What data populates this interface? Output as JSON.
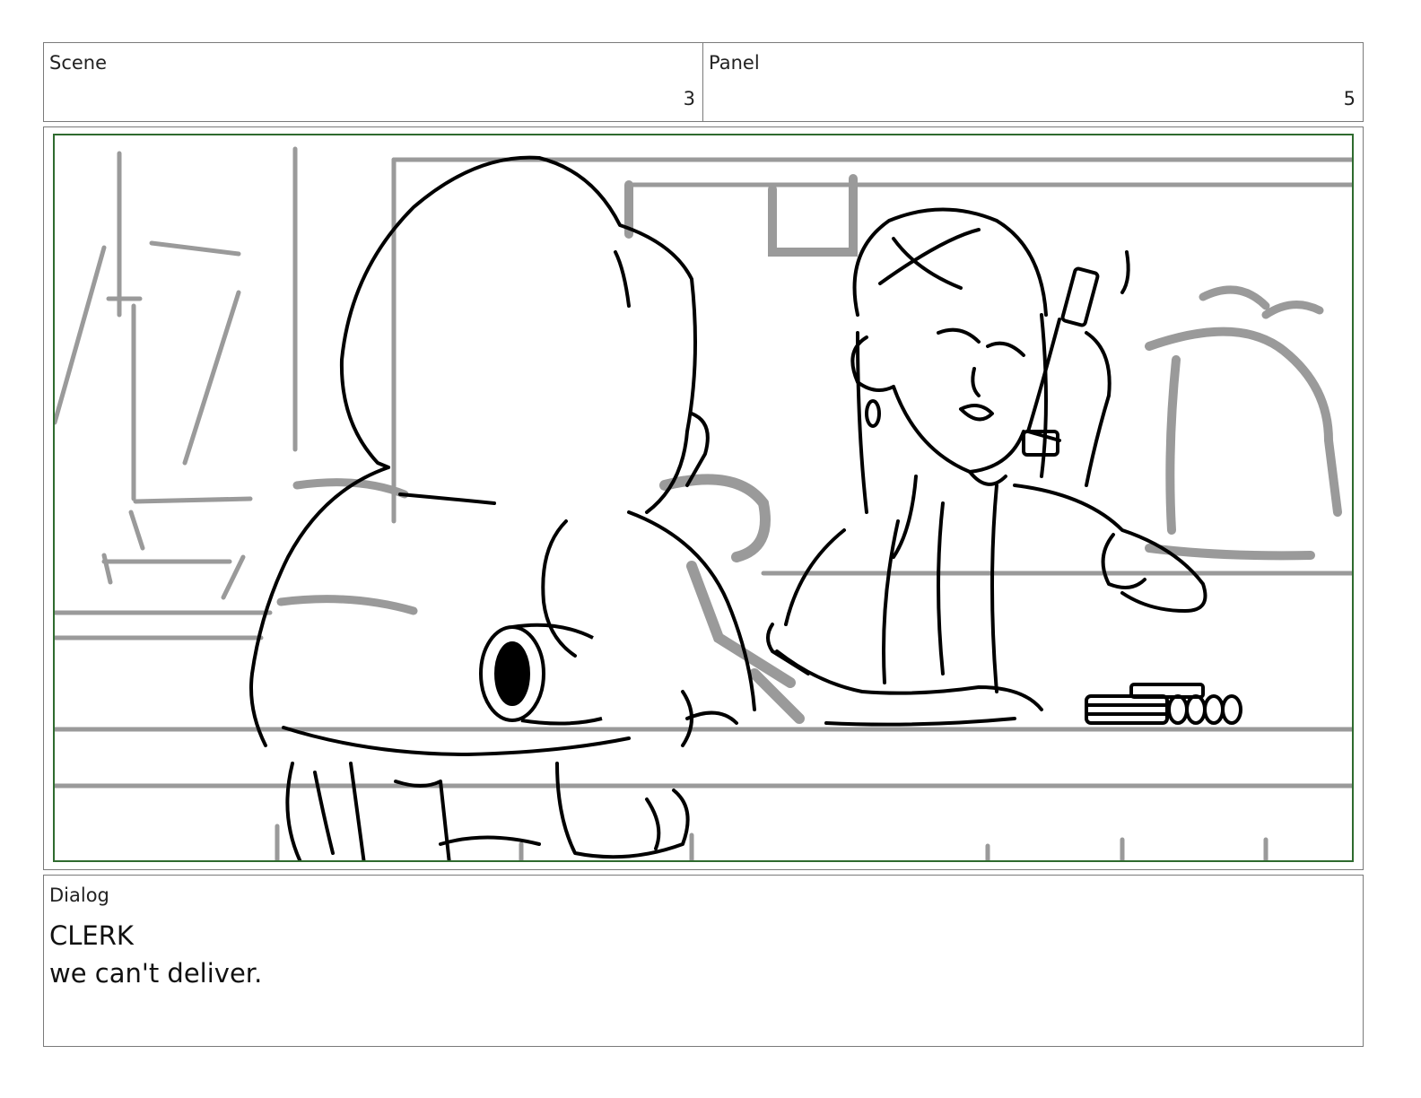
{
  "scene": {
    "label": "Scene",
    "number": "3"
  },
  "panel": {
    "label": "Panel",
    "number": "5"
  },
  "dialog": {
    "label": "Dialog",
    "speaker": "CLERK",
    "line": "we can't deliver."
  },
  "colors": {
    "frame_border": "#7a7a7a",
    "safe_area": "#2f6b2f",
    "sketch_gray": "#9a9a9a",
    "ink": "#000000"
  },
  "illustration": {
    "subject": "storyboard-sketch-customer-and-clerk-on-phone"
  }
}
